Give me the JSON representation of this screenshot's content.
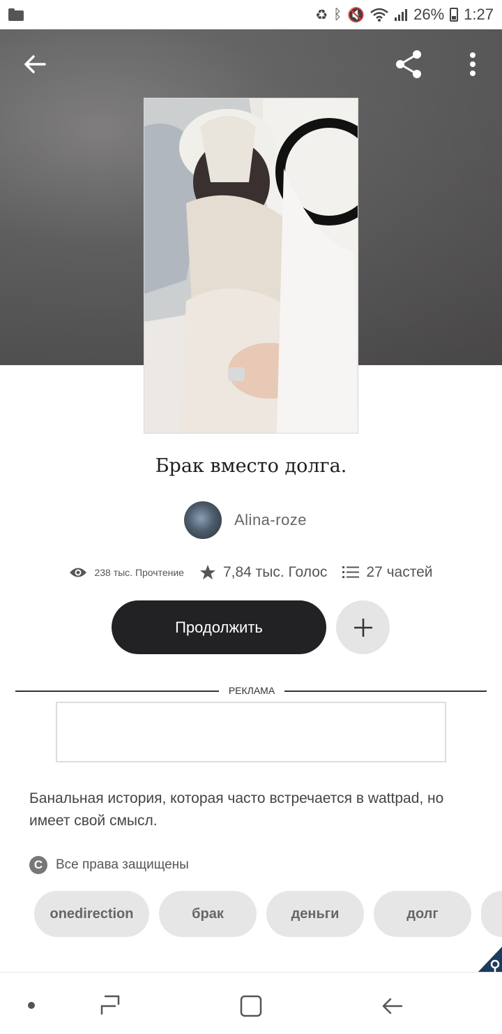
{
  "status_bar": {
    "battery": "26%",
    "time": "1:27"
  },
  "story": {
    "title": "Брак вместо долга.",
    "author": "Alina-roze",
    "reads": "238 тыс. Прочтение",
    "votes": "7,84 тыс. Голос",
    "parts": "27 частей",
    "continue_label": "Продолжить",
    "ad_label": "РЕКЛАМА",
    "description": "Банальная история, которая часто встречается в wattpad, но имеет свой смысл.",
    "rights": "Все права защищены",
    "tags": [
      "onedirection",
      "брак",
      "деньги",
      "долг"
    ]
  }
}
